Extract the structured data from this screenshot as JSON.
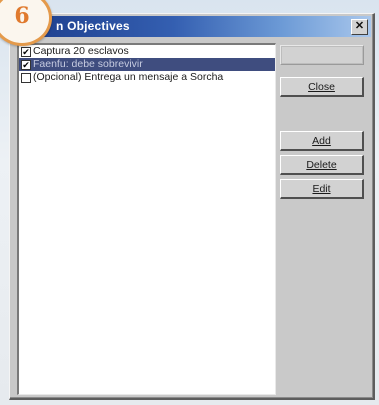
{
  "badge": {
    "number": "6"
  },
  "window": {
    "title": "n Objectives",
    "close_glyph": "✕"
  },
  "objectives": [
    {
      "label": "Captura 20 esclavos",
      "checked": true,
      "selected": false
    },
    {
      "label": "Faenfu: debe sobrevivir",
      "checked": true,
      "selected": true
    },
    {
      "label": "(Opcional) Entrega un mensaje a Sorcha",
      "checked": false,
      "selected": false
    }
  ],
  "buttons": {
    "blank": "",
    "close": "Close",
    "add": "Add",
    "delete": "Delete",
    "edit": "Edit"
  },
  "icons": {
    "close": "close-icon",
    "checkbox": "checkbox-icon"
  },
  "colors": {
    "badge_accent": "#e07a2e",
    "title_bar": "#1c3c8a",
    "selection": "#3f4d7f"
  }
}
